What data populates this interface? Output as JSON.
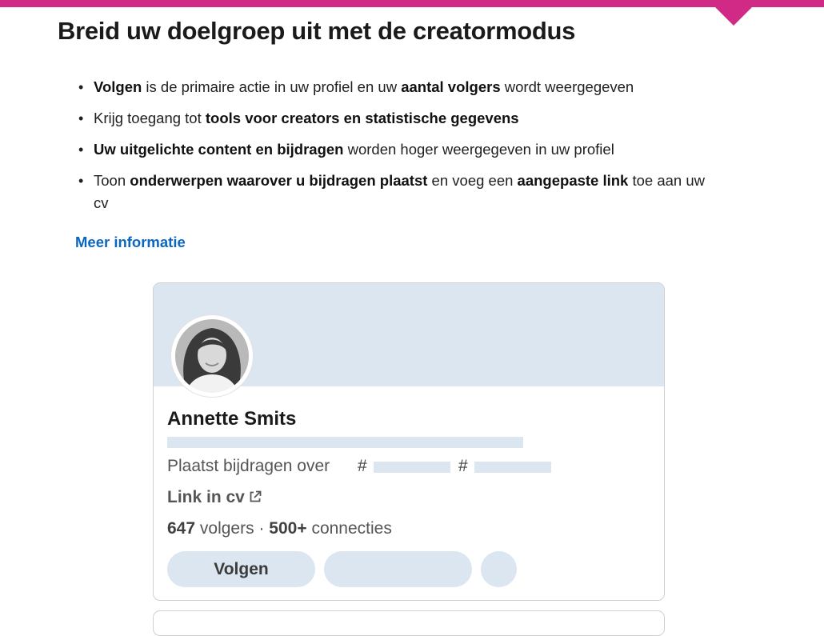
{
  "heading": "Breid uw doelgroep uit met de creatormodus",
  "benefits": [
    {
      "parts": [
        {
          "t": "Volgen",
          "b": true
        },
        {
          "t": " is de primaire actie in uw profiel en uw ",
          "b": false
        },
        {
          "t": "aantal volgers",
          "b": true
        },
        {
          "t": " wordt weergegeven",
          "b": false
        }
      ]
    },
    {
      "parts": [
        {
          "t": "Krijg toegang tot ",
          "b": false
        },
        {
          "t": "tools voor creators en statistische gegevens",
          "b": true
        }
      ]
    },
    {
      "parts": [
        {
          "t": "Uw uitgelichte content en bijdragen",
          "b": true
        },
        {
          "t": " worden hoger weergegeven in uw profiel",
          "b": false
        }
      ]
    },
    {
      "parts": [
        {
          "t": "Toon ",
          "b": false
        },
        {
          "t": "onderwerpen waarover u bijdragen plaatst",
          "b": true
        },
        {
          "t": " en voeg een ",
          "b": false
        },
        {
          "t": "aangepaste link",
          "b": true
        },
        {
          "t": " toe aan uw cv",
          "b": false
        }
      ]
    }
  ],
  "more_info_label": "Meer informatie",
  "profile": {
    "name": "Annette Smits",
    "topics_prefix": "Plaatst bijdragen over",
    "hash_symbol": "#",
    "cv_link_label": "Link in cv",
    "followers_count": "647",
    "followers_label": "volgers",
    "separator": "·",
    "connections_count": "500+",
    "connections_label": "connecties",
    "follow_button_label": "Volgen"
  },
  "colors": {
    "accent_bar": "#d02a86",
    "link": "#0a66c2",
    "placeholder": "#dce6f1"
  },
  "icons": {
    "external_link": "external-link-icon"
  }
}
